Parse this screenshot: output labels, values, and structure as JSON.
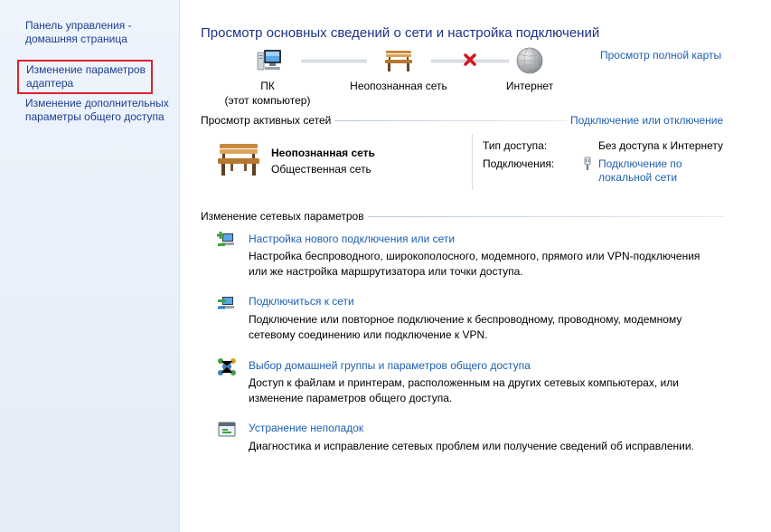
{
  "sidebar": {
    "items": [
      {
        "line1": "Панель управления -",
        "line2": "домашняя страница"
      },
      {
        "line1": "Изменение параметров",
        "line2": "адаптера"
      },
      {
        "line1": "Изменение дополнительных",
        "line2": "параметры общего доступа"
      }
    ]
  },
  "header": {
    "title": "Просмотр основных сведений о сети и настройка подключений",
    "full_map_link": "Просмотр полной карты"
  },
  "network_map": {
    "computer_label": "ПК",
    "computer_sub": "(этот компьютер)",
    "network_label": "Неопознанная сеть",
    "internet_label": "Интернет"
  },
  "active_networks": {
    "heading": "Просмотр активных сетей",
    "connect_link": "Подключение или отключение",
    "network_name": "Неопознанная сеть",
    "network_type": "Общественная сеть",
    "access_type_label": "Тип доступа:",
    "access_type_value": "Без доступа к Интернету",
    "connections_label": "Подключения:",
    "connection_link_line1": "Подключение по",
    "connection_link_line2": "локальной сети"
  },
  "change_settings": {
    "heading": "Изменение сетевых параметров",
    "tasks": [
      {
        "title": "Настройка нового подключения или сети",
        "desc1": "Настройка беспроводного, широкополосного, модемного, прямого или VPN-подключения",
        "desc2": "или же настройка маршрутизатора или точки доступа."
      },
      {
        "title": "Подключиться к сети",
        "desc1": "Подключение или повторное подключение к беспроводному, проводному, модемному",
        "desc2": "сетевому соединению или подключение к VPN."
      },
      {
        "title": "Выбор домашней группы и параметров общего доступа",
        "desc1": "Доступ к файлам и принтерам, расположенным на других сетевых компьютерах, или",
        "desc2": "изменение параметров общего доступа."
      },
      {
        "title": "Устранение неполадок",
        "desc1": "Диагностика и исправление сетевых проблем или получение сведений об исправлении."
      }
    ]
  },
  "colors": {
    "link": "#1c5fb0",
    "title": "#1e3287",
    "highlight_box": "#e0232b",
    "sidebar_bg": "#e9f0f9"
  }
}
